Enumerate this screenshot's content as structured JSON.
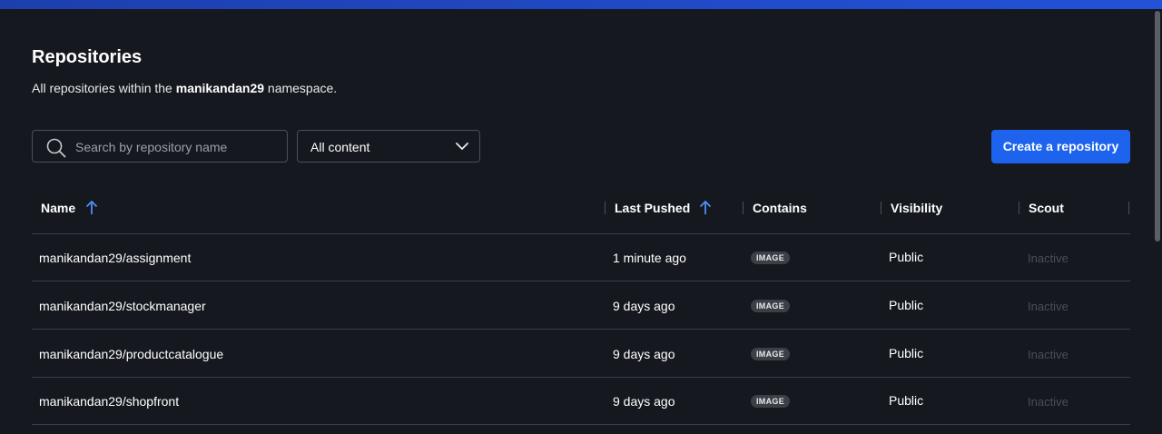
{
  "header": {
    "title": "Repositories",
    "subtitle_prefix": "All repositories within the",
    "namespace": "manikandan29",
    "subtitle_suffix": "namespace."
  },
  "toolbar": {
    "search_placeholder": "Search by repository name",
    "filter_selected": "All content",
    "create_label": "Create a repository"
  },
  "table": {
    "columns": [
      "Name",
      "Last Pushed",
      "Contains",
      "Visibility",
      "Scout"
    ],
    "rows": [
      {
        "name": "manikandan29/assignment",
        "pushed": "1 minute ago",
        "contains": "IMAGE",
        "visibility": "Public",
        "scout": "Inactive"
      },
      {
        "name": "manikandan29/stockmanager",
        "pushed": "9 days ago",
        "contains": "IMAGE",
        "visibility": "Public",
        "scout": "Inactive"
      },
      {
        "name": "manikandan29/productcatalogue",
        "pushed": "9 days ago",
        "contains": "IMAGE",
        "visibility": "Public",
        "scout": "Inactive"
      },
      {
        "name": "manikandan29/shopfront",
        "pushed": "9 days ago",
        "contains": "IMAGE",
        "visibility": "Public",
        "scout": "Inactive"
      }
    ]
  },
  "colors": {
    "background": "#15181f",
    "accent": "#1d63ed",
    "sort_arrow": "#4f8ff7"
  },
  "icons": [
    "search-icon",
    "chevron-down-icon",
    "sort-ascending-icon"
  ]
}
